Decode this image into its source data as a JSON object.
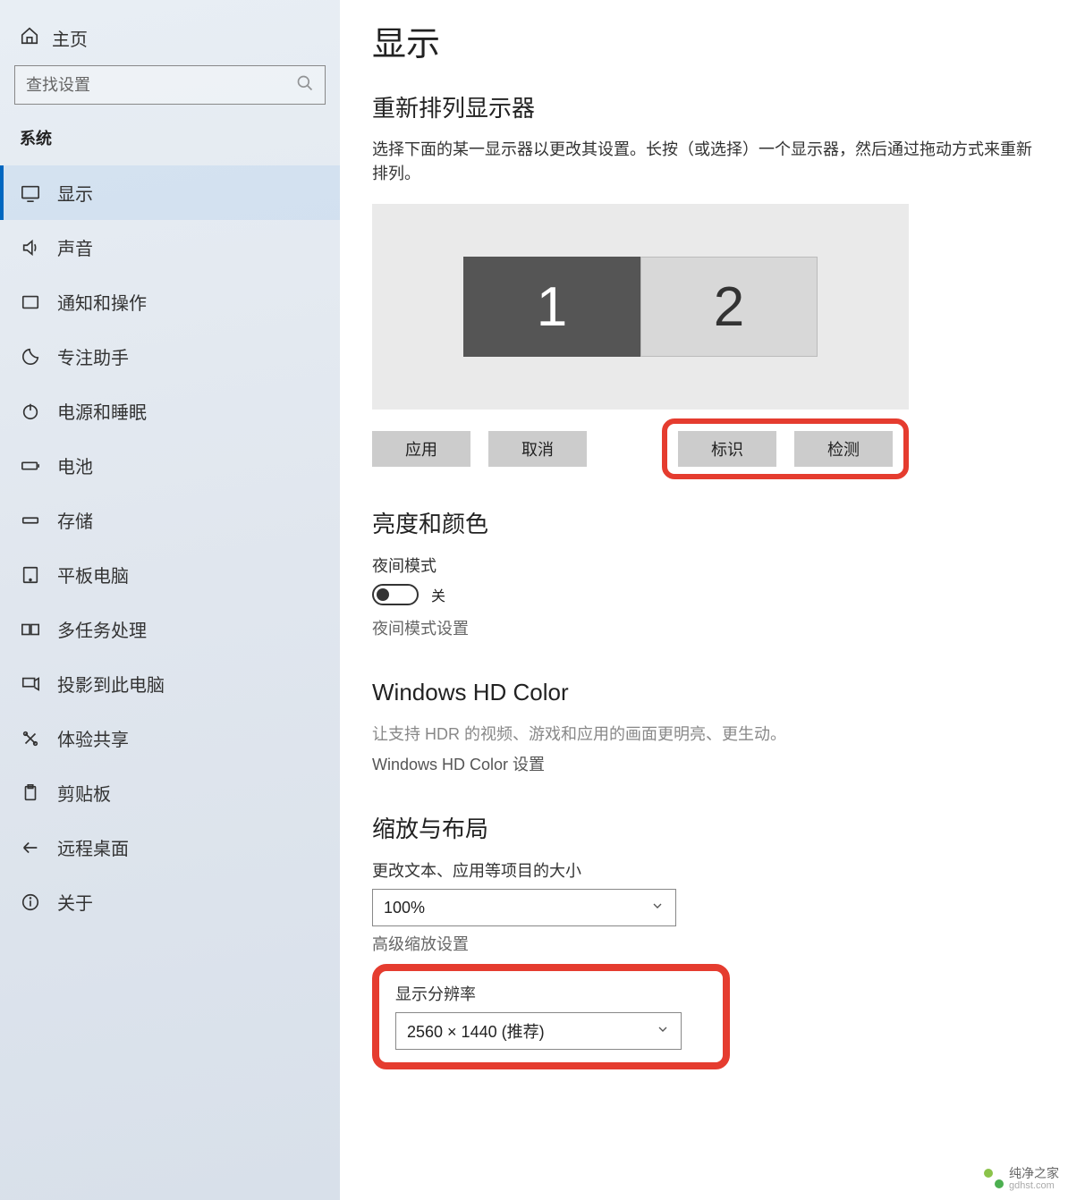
{
  "sidebar": {
    "home": "主页",
    "search_placeholder": "查找设置",
    "section": "系统",
    "items": [
      {
        "label": "显示"
      },
      {
        "label": "声音"
      },
      {
        "label": "通知和操作"
      },
      {
        "label": "专注助手"
      },
      {
        "label": "电源和睡眠"
      },
      {
        "label": "电池"
      },
      {
        "label": "存储"
      },
      {
        "label": "平板电脑"
      },
      {
        "label": "多任务处理"
      },
      {
        "label": "投影到此电脑"
      },
      {
        "label": "体验共享"
      },
      {
        "label": "剪贴板"
      },
      {
        "label": "远程桌面"
      },
      {
        "label": "关于"
      }
    ]
  },
  "main": {
    "title": "显示",
    "rearrange": {
      "heading": "重新排列显示器",
      "desc": "选择下面的某一显示器以更改其设置。长按（或选择）一个显示器，然后通过拖动方式来重新排列。",
      "monitor1": "1",
      "monitor2": "2",
      "apply": "应用",
      "cancel": "取消",
      "identify": "标识",
      "detect": "检测"
    },
    "brightness": {
      "heading": "亮度和颜色",
      "night_label": "夜间模式",
      "night_state": "关",
      "night_settings": "夜间模式设置"
    },
    "hdcolor": {
      "heading": "Windows HD Color",
      "desc": "让支持 HDR 的视频、游戏和应用的画面更明亮、更生动。",
      "link": "Windows HD Color 设置"
    },
    "scale": {
      "heading": "缩放与布局",
      "text_size_label": "更改文本、应用等项目的大小",
      "text_size_value": "100%",
      "advanced_link": "高级缩放设置",
      "resolution_label": "显示分辨率",
      "resolution_value": "2560 × 1440 (推荐)"
    }
  },
  "watermark": {
    "name": "纯净之家",
    "url": "gdhst.com"
  }
}
